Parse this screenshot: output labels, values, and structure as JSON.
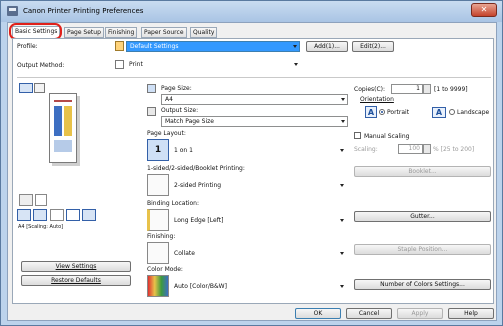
{
  "window": {
    "title": "Canon Printer Printing Preferences",
    "close_glyph": "✕"
  },
  "tabs": [
    {
      "label": "Basic Settings"
    },
    {
      "label": "Page Setup"
    },
    {
      "label": "Finishing"
    },
    {
      "label": "Paper Source"
    },
    {
      "label": "Quality"
    }
  ],
  "profile": {
    "label": "Profile:",
    "value": "Default Settings",
    "add_label": "Add(1)...",
    "edit_label": "Edit(2)..."
  },
  "output_method": {
    "label": "Output Method:",
    "value": "Print"
  },
  "preview": {
    "caption": "A4 [Scaling: Auto]"
  },
  "view_settings_label": "View Settings",
  "restore_defaults_label": "Restore Defaults",
  "page_size": {
    "label": "Page Size:",
    "value": "A4"
  },
  "output_size": {
    "label": "Output Size:",
    "value": "Match Page Size"
  },
  "page_layout": {
    "label": "Page Layout:",
    "value": "1 on 1",
    "badge": "1"
  },
  "sided": {
    "label": "1-sided/2-sided/Booklet Printing:",
    "value": "2-sided Printing"
  },
  "binding": {
    "label": "Binding Location:",
    "value": "Long Edge [Left]"
  },
  "finishing": {
    "label": "Finishing:",
    "value": "Collate"
  },
  "color_mode": {
    "label": "Color Mode:",
    "value": "Auto [Color/B&W]"
  },
  "copies": {
    "label": "Copies(C):",
    "value": "1",
    "range": "[1 to 9999]"
  },
  "orientation": {
    "label": "Orientation",
    "portrait": "Portrait",
    "landscape": "Landscape",
    "glyph": "A"
  },
  "manual_scaling": {
    "label": "Manual Scaling"
  },
  "scaling": {
    "label": "Scaling:",
    "value": "100",
    "range": "% [25 to 200]"
  },
  "booklet_label": "Booklet...",
  "gutter_label": "Gutter...",
  "staple_label": "Staple Position...",
  "num_colors_label": "Number of Colors Settings...",
  "footer": {
    "ok": "OK",
    "cancel": "Cancel",
    "apply": "Apply",
    "help": "Help"
  }
}
